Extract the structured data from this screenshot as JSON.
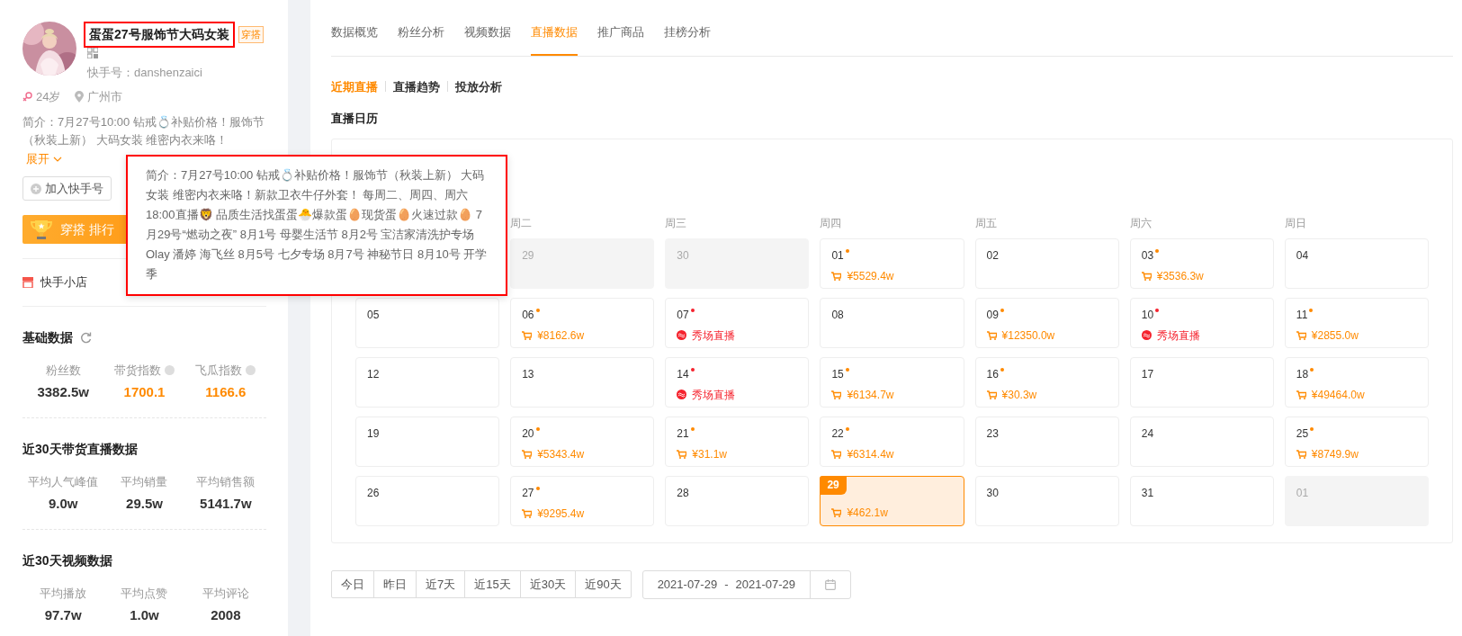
{
  "profile": {
    "name": "蛋蛋27号服饰节大码女装",
    "tag": "穿搭",
    "account": "快手号：danshenzaici",
    "age": "24岁",
    "city": "广州市",
    "bio": "简介：7月27号10:00 钻戒💍补贴价格！服饰节（秋装上新） 大码女装 维密内衣来咯！",
    "expand": "展开",
    "follow_button": "加入快手号",
    "rank_banner": "穿搭 排行",
    "shop": "快手小店"
  },
  "sections": [
    {
      "title": "基础数据",
      "refresh": true,
      "stats": [
        {
          "label": "粉丝数",
          "value": "3382.5w",
          "highlight": false,
          "help": false
        },
        {
          "label": "带货指数",
          "value": "1700.1",
          "highlight": true,
          "help": true
        },
        {
          "label": "飞瓜指数",
          "value": "1166.6",
          "highlight": true,
          "help": true
        }
      ]
    },
    {
      "title": "近30天带货直播数据",
      "refresh": false,
      "stats": [
        {
          "label": "平均人气峰值",
          "value": "9.0w",
          "highlight": false,
          "help": false
        },
        {
          "label": "平均销量",
          "value": "29.5w",
          "highlight": false,
          "help": false
        },
        {
          "label": "平均销售额",
          "value": "5141.7w",
          "highlight": false,
          "help": false
        }
      ]
    },
    {
      "title": "近30天视频数据",
      "refresh": false,
      "stats": [
        {
          "label": "平均播放",
          "value": "97.7w",
          "highlight": false,
          "help": false
        },
        {
          "label": "平均点赞",
          "value": "1.0w",
          "highlight": false,
          "help": false
        },
        {
          "label": "平均评论",
          "value": "2008",
          "highlight": false,
          "help": false
        }
      ]
    }
  ],
  "tooltip": "简介：7月27号10:00 钻戒💍补贴价格！服饰节（秋装上新） 大码女装 维密内衣来咯！新款卫衣牛仔外套！ 每周二、周四、周六18:00直播🦁 品质生活找蛋蛋🐣爆款蛋🥚现货蛋🥚火速过款🥚 7月29号“燃动之夜” 8月1号 母婴生活节 8月2号 宝洁家清洗护专场 Olay 潘婷 海飞丝 8月5号 七夕专场 8月7号 神秘节日 8月10号 开学季",
  "tabs": [
    {
      "label": "数据概览",
      "selected": false
    },
    {
      "label": "粉丝分析",
      "selected": false
    },
    {
      "label": "视频数据",
      "selected": false
    },
    {
      "label": "直播数据",
      "selected": true
    },
    {
      "label": "推广商品",
      "selected": false
    },
    {
      "label": "挂榜分析",
      "selected": false
    }
  ],
  "subtabs": [
    {
      "label": "近期直播",
      "selected": true
    },
    {
      "label": "直播趋势",
      "selected": false
    },
    {
      "label": "投放分析",
      "selected": false
    }
  ],
  "calendar": {
    "title": "直播日历",
    "weekdays": [
      "周二",
      "周三",
      "周四",
      "周五",
      "周六",
      "周日"
    ],
    "weeks": [
      [
        {
          "day": "29",
          "muted": true,
          "selected": false
        },
        {
          "day": "30",
          "muted": true,
          "selected": false
        },
        {
          "day": "01",
          "muted": false,
          "selected": false,
          "color": "#ff8a00",
          "event": {
            "kind": "sales",
            "text": "¥5529.4w"
          }
        },
        {
          "day": "02",
          "muted": false,
          "selected": false
        },
        {
          "day": "03",
          "muted": false,
          "selected": false,
          "color": "#ff8a00",
          "event": {
            "kind": "sales",
            "text": "¥3536.3w"
          }
        },
        {
          "day": "04",
          "muted": false,
          "selected": false
        }
      ],
      [
        {
          "day": "05",
          "muted": false,
          "selected": false
        },
        {
          "day": "06",
          "muted": false,
          "selected": false,
          "color": "#ff8a00",
          "event": {
            "kind": "sales",
            "text": "¥8162.6w"
          }
        },
        {
          "day": "07",
          "muted": false,
          "selected": false,
          "color": "#f5222d",
          "event": {
            "kind": "show",
            "text": "秀场直播"
          }
        },
        {
          "day": "08",
          "muted": false,
          "selected": false
        },
        {
          "day": "09",
          "muted": false,
          "selected": false,
          "color": "#ff8a00",
          "event": {
            "kind": "sales",
            "text": "¥12350.0w"
          }
        },
        {
          "day": "10",
          "muted": false,
          "selected": false,
          "color": "#f5222d",
          "event": {
            "kind": "show",
            "text": "秀场直播"
          }
        },
        {
          "day": "11",
          "muted": false,
          "selected": false,
          "color": "#ff8a00",
          "event": {
            "kind": "sales",
            "text": "¥2855.0w"
          }
        }
      ],
      [
        {
          "day": "12",
          "muted": false,
          "selected": false
        },
        {
          "day": "13",
          "muted": false,
          "selected": false
        },
        {
          "day": "14",
          "muted": false,
          "selected": false,
          "color": "#f5222d",
          "event": {
            "kind": "show",
            "text": "秀场直播"
          }
        },
        {
          "day": "15",
          "muted": false,
          "selected": false,
          "color": "#ff8a00",
          "event": {
            "kind": "sales",
            "text": "¥6134.7w"
          }
        },
        {
          "day": "16",
          "muted": false,
          "selected": false,
          "color": "#ff8a00",
          "event": {
            "kind": "sales",
            "text": "¥30.3w"
          }
        },
        {
          "day": "17",
          "muted": false,
          "selected": false
        },
        {
          "day": "18",
          "muted": false,
          "selected": false,
          "color": "#ff8a00",
          "event": {
            "kind": "sales",
            "text": "¥49464.0w"
          }
        }
      ],
      [
        {
          "day": "19",
          "muted": false,
          "selected": false
        },
        {
          "day": "20",
          "muted": false,
          "selected": false,
          "color": "#ff8a00",
          "event": {
            "kind": "sales",
            "text": "¥5343.4w"
          }
        },
        {
          "day": "21",
          "muted": false,
          "selected": false,
          "color": "#ff8a00",
          "event": {
            "kind": "sales",
            "text": "¥31.1w"
          }
        },
        {
          "day": "22",
          "muted": false,
          "selected": false,
          "color": "#ff8a00",
          "event": {
            "kind": "sales",
            "text": "¥6314.4w"
          }
        },
        {
          "day": "23",
          "muted": false,
          "selected": false
        },
        {
          "day": "24",
          "muted": false,
          "selected": false
        },
        {
          "day": "25",
          "muted": false,
          "selected": false,
          "color": "#ff8a00",
          "event": {
            "kind": "sales",
            "text": "¥8749.9w"
          }
        }
      ],
      [
        {
          "day": "26",
          "muted": false,
          "selected": false
        },
        {
          "day": "27",
          "muted": false,
          "selected": false,
          "color": "#ff8a00",
          "event": {
            "kind": "sales",
            "text": "¥9295.4w"
          }
        },
        {
          "day": "28",
          "muted": false,
          "selected": false
        },
        {
          "day": "29",
          "muted": false,
          "selected": true,
          "event": {
            "kind": "sales",
            "text": "¥462.1w"
          }
        },
        {
          "day": "30",
          "muted": false,
          "selected": false
        },
        {
          "day": "31",
          "muted": false,
          "selected": false
        },
        {
          "day": "01",
          "muted": true,
          "selected": false
        }
      ]
    ]
  },
  "ranges": [
    {
      "label": "今日",
      "selected": false
    },
    {
      "label": "昨日",
      "selected": false
    },
    {
      "label": "近7天",
      "selected": false
    },
    {
      "label": "近15天",
      "selected": false
    },
    {
      "label": "近30天",
      "selected": false
    },
    {
      "label": "近90天",
      "selected": false
    }
  ],
  "date_range": {
    "start": "2021-07-29",
    "separator": "-",
    "end": "2021-07-29"
  }
}
